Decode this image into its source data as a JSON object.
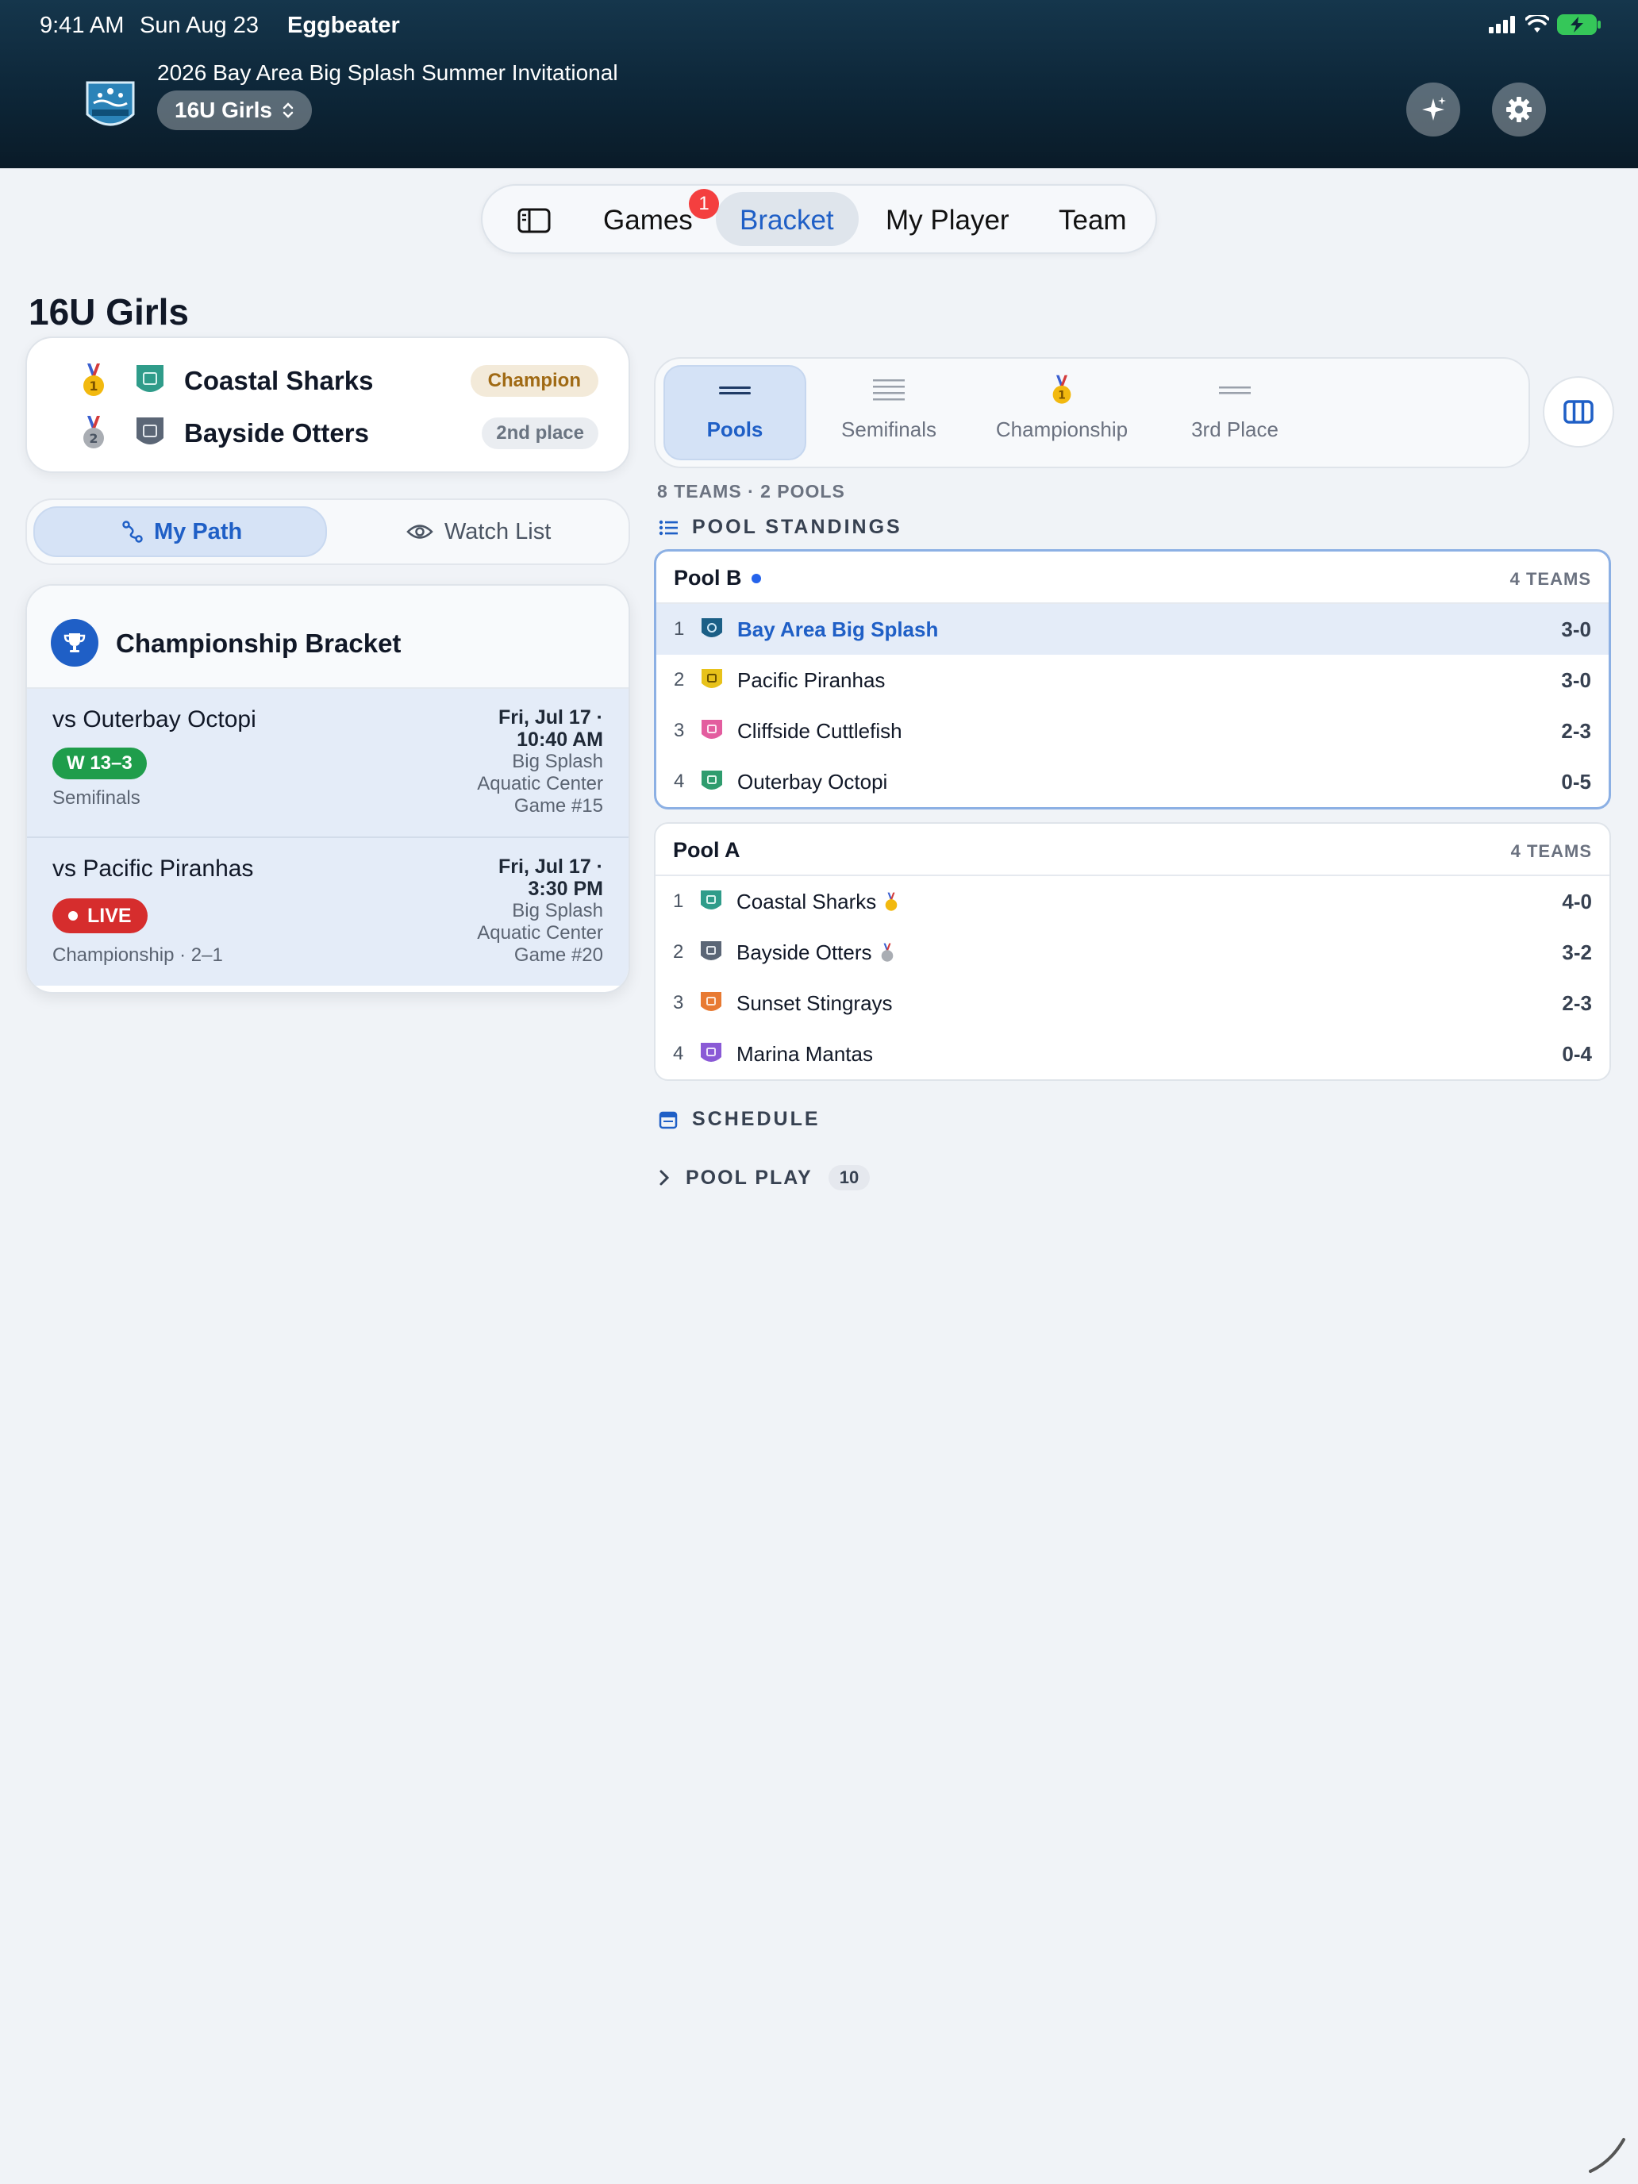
{
  "status_bar": {
    "time": "9:41 AM",
    "date": "Sun Aug 23",
    "app": "Eggbeater"
  },
  "header": {
    "event_title": "2026 Bay Area Big Splash Summer Invitational",
    "division": "16U Girls",
    "icons": [
      "sparkles-icon",
      "gear-icon"
    ]
  },
  "tabs": {
    "items": [
      "Games",
      "Bracket",
      "My Player",
      "Team"
    ],
    "active": "Bracket",
    "games_badge": "1"
  },
  "page_title": "16U Girls",
  "podium": [
    {
      "place_icon": "gold-medal-icon",
      "team": "Coastal Sharks",
      "label": "Champion"
    },
    {
      "place_icon": "silver-medal-icon",
      "team": "Bayside Otters",
      "label": "2nd place"
    }
  ],
  "path_toggle": {
    "my_path": "My Path",
    "watch_list": "Watch List",
    "active": "My Path"
  },
  "bracket_card": {
    "title": "Championship Bracket",
    "games": [
      {
        "opponent": "vs Outerbay Octopi",
        "result": "W 13–3",
        "round": "Semifinals",
        "datetime_line1": "Fri, Jul 17 ·",
        "datetime_line2": "10:40 AM",
        "venue_line1": "Big Splash",
        "venue_line2": "Aquatic Center",
        "game_no": "Game #15"
      },
      {
        "opponent": "vs Pacific Piranhas",
        "result": "LIVE",
        "round": "Championship · 2–1",
        "datetime_line1": "Fri, Jul 17 ·",
        "datetime_line2": "3:30 PM",
        "venue_line1": "Big Splash",
        "venue_line2": "Aquatic Center",
        "game_no": "Game #20"
      }
    ]
  },
  "stages": {
    "items": [
      "Pools",
      "Semifinals",
      "Championship",
      "3rd Place"
    ],
    "active": "Pools"
  },
  "summary": "8 TEAMS · 2 POOLS",
  "standings_heading": "POOL STANDINGS",
  "pools": [
    {
      "name": "Pool B",
      "count": "4 TEAMS",
      "rows": [
        {
          "rank": "1",
          "team": "Bay Area Big Splash",
          "record": "3-0",
          "color": "#1b5f86"
        },
        {
          "rank": "2",
          "team": "Pacific Piranhas",
          "record": "3-0",
          "color": "#e8c21a"
        },
        {
          "rank": "3",
          "team": "Cliffside Cuttlefish",
          "record": "2-3",
          "color": "#e35d9f"
        },
        {
          "rank": "4",
          "team": "Outerbay Octopi",
          "record": "0-5",
          "color": "#2f9c6e"
        }
      ]
    },
    {
      "name": "Pool A",
      "count": "4 TEAMS",
      "rows": [
        {
          "rank": "1",
          "team": "Coastal Sharks",
          "record": "4-0",
          "color": "#2f9c8a"
        },
        {
          "rank": "2",
          "team": "Bayside Otters",
          "record": "3-2",
          "color": "#5b6676"
        },
        {
          "rank": "3",
          "team": "Sunset Stingrays",
          "record": "2-3",
          "color": "#e87a32"
        },
        {
          "rank": "4",
          "team": "Marina Mantas",
          "record": "0-4",
          "color": "#8a5ad6"
        }
      ]
    }
  ],
  "schedule_heading": "SCHEDULE",
  "pool_play": {
    "label": "POOL PLAY",
    "count": "10"
  },
  "colors": {
    "accent": "#1f5fc6",
    "win": "#1f9d4b",
    "live": "#d62d2d",
    "header_dark": "#0d2638"
  }
}
